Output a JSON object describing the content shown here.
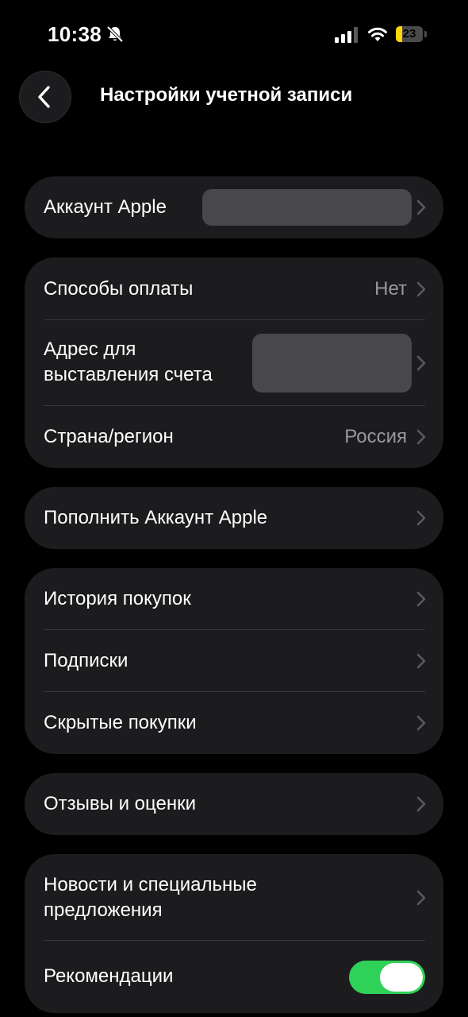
{
  "status_bar": {
    "time": "10:38",
    "battery_level": "23",
    "icons": [
      "bell-slash-icon",
      "cellular-signal-icon",
      "wifi-icon",
      "battery-icon"
    ]
  },
  "header": {
    "title": "Настройки учетной записи",
    "back_icon": "chevron-left-icon"
  },
  "sections": {
    "apple_account": {
      "label": "Аккаунт Apple"
    },
    "payment": {
      "methods_label": "Способы оплаты",
      "methods_value": "Нет",
      "billing_label_line1": "Адрес для",
      "billing_label_line2": "выставления счета",
      "country_label": "Страна/регион",
      "country_value": "Россия"
    },
    "top_up": {
      "label": "Пополнить Аккаунт Apple"
    },
    "purchases": {
      "history_label": "История покупок",
      "subscriptions_label": "Подписки",
      "hidden_label": "Скрытые покупки"
    },
    "reviews": {
      "label": "Отзывы и оценки"
    },
    "news": {
      "label_line1": "Новости и специальные",
      "label_line2": "предложения",
      "recommendations_label": "Рекомендации",
      "recommendations_enabled": true
    }
  },
  "colors": {
    "background": "#000000",
    "card": "#1c1c1e",
    "secondary_text": "#98989f",
    "toggle_on": "#30d158",
    "battery_fill": "#ffd60a",
    "redaction": "#48484a"
  }
}
